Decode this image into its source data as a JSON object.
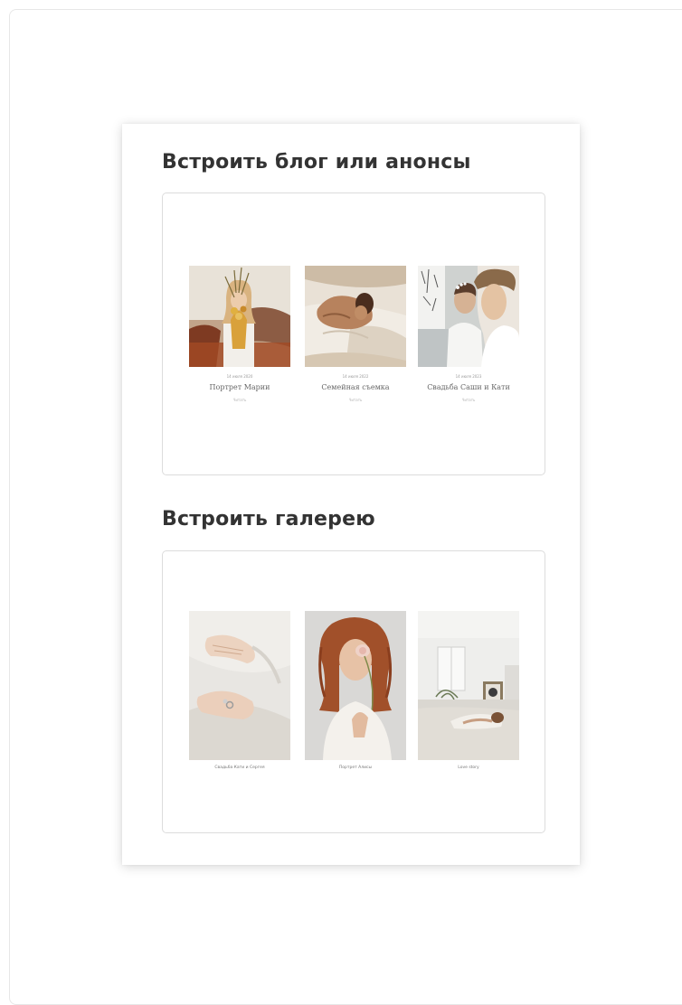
{
  "sections": {
    "blog": {
      "title": "Встроить блог или анонсы",
      "posts": [
        {
          "date": "14 июля 2020",
          "title": "Портрет Марии",
          "more": "Читать",
          "image": "woman-with-dried-flowers-photo"
        },
        {
          "date": "14 июля 2022",
          "title": "Семейная съемка",
          "more": "Читать",
          "image": "woman-lying-on-bed-photo"
        },
        {
          "date": "14 июля 2023",
          "title": "Свадьба Саши и Кати",
          "more": "Читать",
          "image": "two-women-in-white-photo"
        }
      ]
    },
    "gallery": {
      "title": "Встроить галерею",
      "items": [
        {
          "caption": "Свадьба Кати и Сергея",
          "image": "hands-with-rings-photo"
        },
        {
          "caption": "Портрет Алисы",
          "image": "red-haired-woman-with-flower-photo"
        },
        {
          "caption": "Love story",
          "image": "woman-relaxing-in-bright-room-photo"
        }
      ]
    }
  },
  "colors": {
    "heading": "#333333",
    "box_border": "#dcdcdc",
    "frame_border": "#e7e7e7"
  }
}
